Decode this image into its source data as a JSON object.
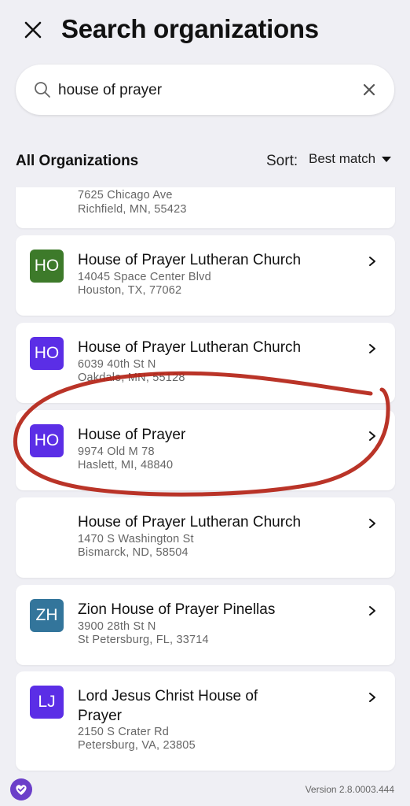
{
  "header": {
    "title": "Search organizations",
    "close_icon": "close-icon"
  },
  "search": {
    "value": "house of prayer",
    "search_icon": "search-icon",
    "clear_icon": "clear-icon"
  },
  "filter": {
    "all_label": "All Organizations",
    "sort_label": "Sort:",
    "sort_value": "Best match"
  },
  "colors": {
    "background": "#efeff4",
    "green": "#3d7a2a",
    "purple": "#5b2ee6",
    "teal": "#33759b",
    "annotation": "#b52518"
  },
  "results": [
    {
      "address_line1": "7625 Chicago Ave",
      "address_line2": "Richfield, MN, 55423"
    },
    {
      "initials": "HO",
      "color": "#3d7a2a",
      "name": "House of Prayer Lutheran Church",
      "address_line1": "14045 Space Center Blvd",
      "address_line2": "Houston, TX, 77062"
    },
    {
      "initials": "HO",
      "color": "#5b2ee6",
      "name": "House of Prayer Lutheran Church",
      "address_line1": "6039 40th St N",
      "address_line2": "Oakdale, MN, 55128"
    },
    {
      "initials": "HO",
      "color": "#5b2ee6",
      "name": "House of Prayer",
      "address_line1": "9974 Old M 78",
      "address_line2": "Haslett, MI, 48840"
    },
    {
      "name": "House of Prayer Lutheran Church",
      "address_line1": "1470 S Washington St",
      "address_line2": "Bismarck, ND, 58504"
    },
    {
      "initials": "ZH",
      "color": "#33759b",
      "name": "Zion House of Prayer Pinellas",
      "address_line1": "3900 28th St N",
      "address_line2": "St Petersburg, FL, 33714"
    },
    {
      "initials": "LJ",
      "color": "#5b2ee6",
      "name_line1": "Lord Jesus Christ House of",
      "name_line2": "Prayer",
      "address_line1": "2150 S Crater Rd",
      "address_line2": "Petersburg, VA, 23805"
    }
  ],
  "footer": {
    "version": "Version 2.8.0003.444",
    "logo_icon": "heart-check-logo-icon"
  }
}
